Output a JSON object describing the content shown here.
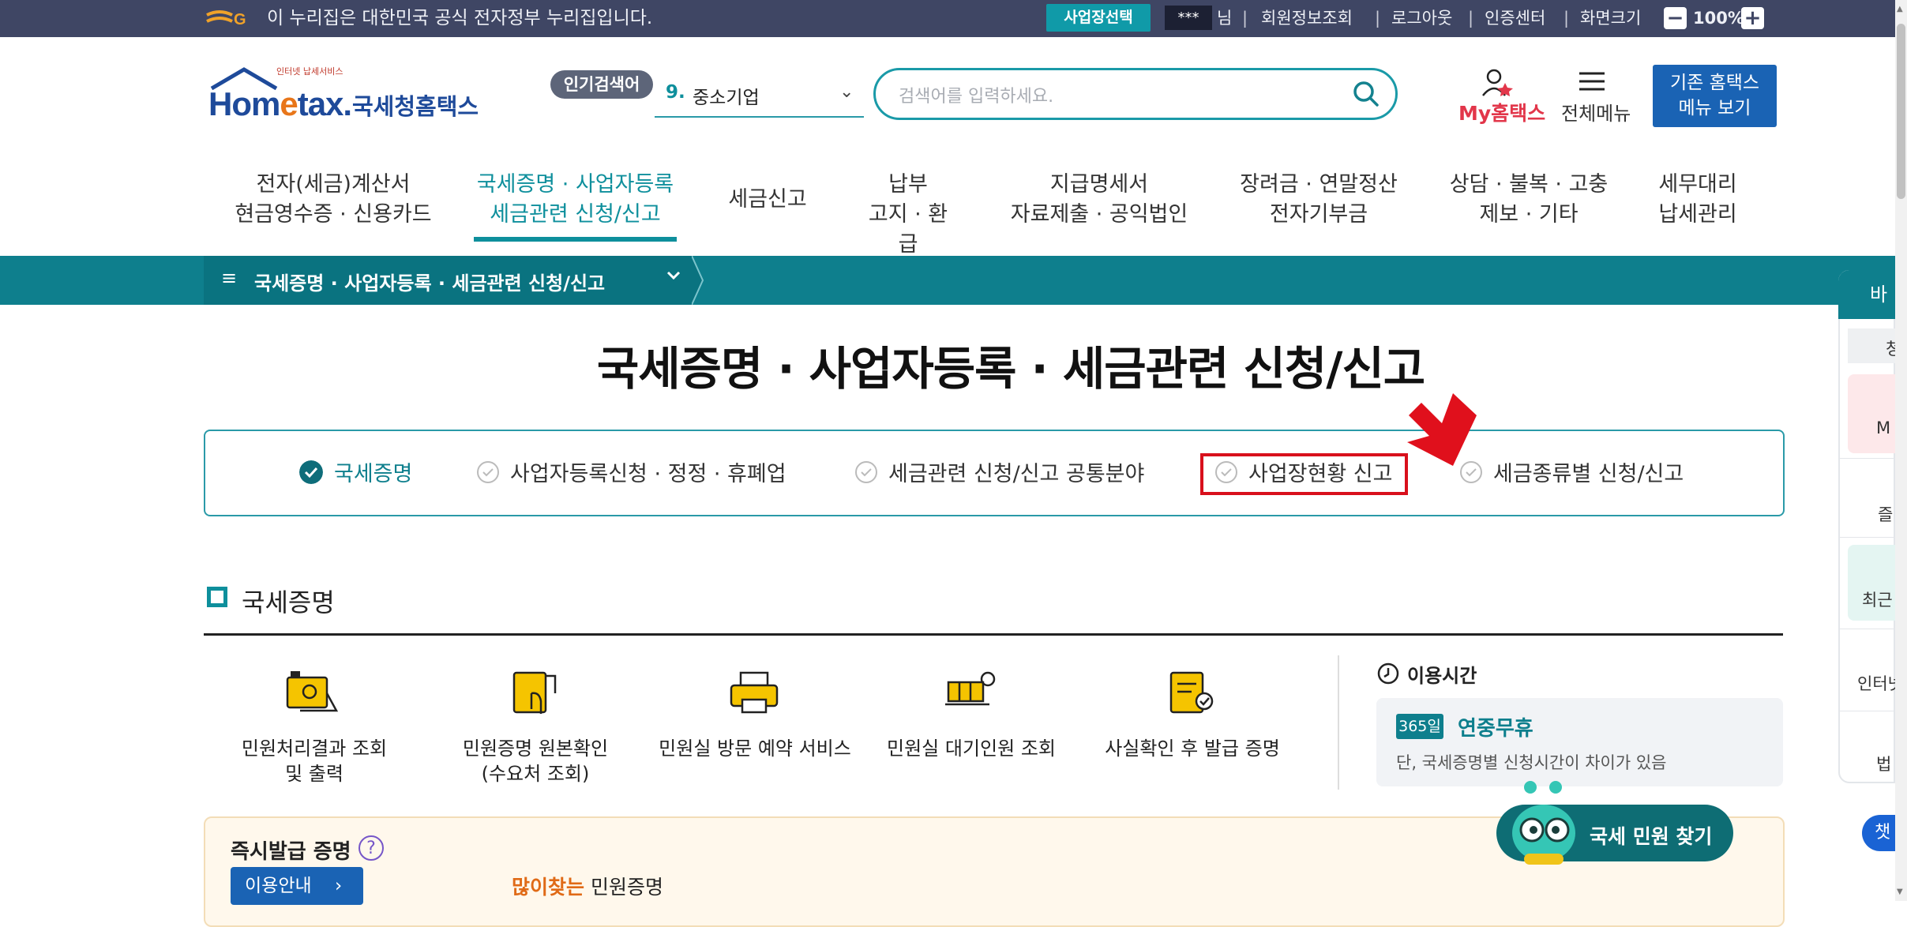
{
  "gov_bar": {
    "notice": "이 누리집은 대한민국 공식 전자정부 누리집입니다.",
    "biz_select": "사업장선택",
    "user_mask": "***",
    "user_suffix": "님",
    "links": [
      "회원정보조회",
      "로그아웃",
      "인증센터",
      "화면크기"
    ],
    "zoom_minus": "−",
    "zoom_value": "100%",
    "zoom_plus": "+"
  },
  "header": {
    "logo_sub": "인터넷 납세서비스",
    "logo_main_a": "Hom",
    "logo_main_e": "e",
    "logo_main_b": "tax.",
    "logo_kr": "국세청홈택스",
    "popular_badge": "인기검색어",
    "popular_rank": "9.",
    "popular_word": "중소기업",
    "search_placeholder": "검색어를 입력하세요.",
    "my_hometax": "My홈택스",
    "all_menu": "전체메뉴",
    "old_hometax_1": "기존 홈택스",
    "old_hometax_2": "메뉴 보기"
  },
  "gnb": [
    {
      "l1": "전자(세금)계산서",
      "l2": "현금영수증 · 신용카드"
    },
    {
      "l1": "국세증명 · 사업자등록",
      "l2": "세금관련 신청/신고"
    },
    {
      "l1": "세금신고",
      "l2": ""
    },
    {
      "l1": "납부",
      "l2": "고지 · 환급"
    },
    {
      "l1": "지급명세서",
      "l2": "자료제출 · 공익법인"
    },
    {
      "l1": "장려금 · 연말정산",
      "l2": "전자기부금"
    },
    {
      "l1": "상담 · 불복 · 고충",
      "l2": "제보 · 기타"
    },
    {
      "l1": "세무대리",
      "l2": "납세관리"
    }
  ],
  "breadcrumb": {
    "current": "국세증명 · 사업자등록 · 세금관련 신청/신고"
  },
  "page": {
    "title": "국세증명 · 사업자등록 · 세금관련 신청/신고"
  },
  "tabs": [
    {
      "label": "국세증명",
      "active": true
    },
    {
      "label": "사업자등록신청 · 정정 · 휴폐업",
      "active": false
    },
    {
      "label": "세금관련 신청/신고 공통분야",
      "active": false
    },
    {
      "label": "사업장현황 신고",
      "active": false
    },
    {
      "label": "세금종류별 신청/신고",
      "active": false
    }
  ],
  "section": {
    "title": "국세증명"
  },
  "services": [
    {
      "l1": "민원처리결과 조회",
      "l2": "및 출력"
    },
    {
      "l1": "민원증명 원본확인",
      "l2": "(수요처 조회)"
    },
    {
      "l1": "민원실 방문 예약 서비스",
      "l2": ""
    },
    {
      "l1": "민원실 대기인원 조회",
      "l2": ""
    },
    {
      "l1": "사실확인 후 발급 증명",
      "l2": ""
    }
  ],
  "hours": {
    "title": "이용시간",
    "badge": "365일",
    "main": "연중무휴",
    "note": "단, 국세증명별 신청시간이 차이가 있음"
  },
  "instant": {
    "title": "즉시발급 증명",
    "help": "?",
    "usage_btn": "이용안내",
    "popular_hl": "많이찾는",
    "popular_rest": " 민원증명"
  },
  "quick_panel": {
    "head": "바",
    "items": [
      "청",
      "M",
      "즐",
      "최근",
      "인터넷",
      "법"
    ]
  },
  "chat": {
    "blue": "챗",
    "find_label": "국세 민원 찾기"
  },
  "colors": {
    "gov_bar": "#3f4664",
    "teal": "#0e8f9c",
    "crumb": "#0e7f8d",
    "blue_btn": "#1a63b4",
    "highlight": "#d8101c",
    "my_red": "#e2364a"
  }
}
